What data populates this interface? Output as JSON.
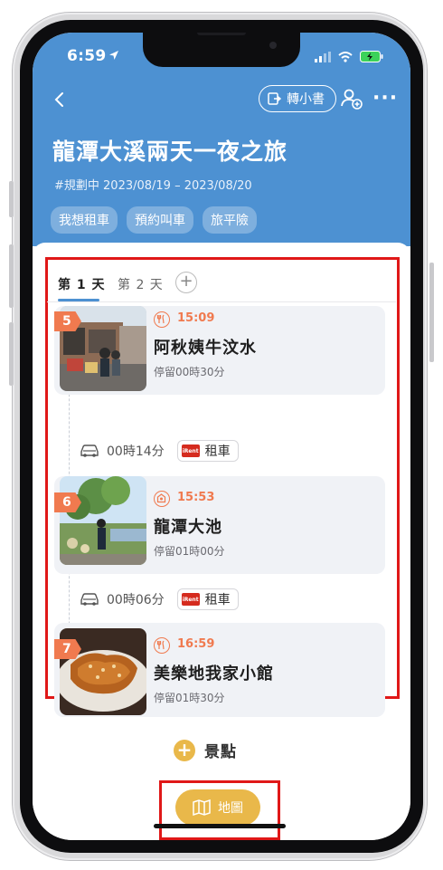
{
  "status_bar": {
    "time": "6:59"
  },
  "header": {
    "convert_label": "轉小書",
    "more_label": "···",
    "title": "龍潭大溪兩天一夜之旅",
    "subtitle": "#規劃中 2023/08/19 – 2023/08/20",
    "chips": [
      "我想租車",
      "預約叫車",
      "旅平險"
    ]
  },
  "tabs": {
    "day1": "第 1 天",
    "day2": "第 2 天",
    "add": "+"
  },
  "stops": [
    {
      "number": "5",
      "time": "15:09",
      "name": "阿秋姨牛汶水",
      "stay": "停留00時30分"
    },
    {
      "number": "6",
      "time": "15:53",
      "name": "龍潭大池",
      "stay": "停留01時00分"
    },
    {
      "number": "7",
      "time": "16:59",
      "name": "美樂地我家小館",
      "stay": "停留01時30分"
    }
  ],
  "transits": [
    {
      "duration": "00時14分",
      "rent_label": "租車",
      "logo_text": "iRent"
    },
    {
      "duration": "00時06分",
      "rent_label": "租車",
      "logo_text": "iRent"
    }
  ],
  "add_spot": {
    "icon": "+",
    "label": "景點"
  },
  "map_button": {
    "label": "地圖"
  },
  "colors": {
    "header_bg": "#4d91d2",
    "accent_orange": "#f07a4f",
    "map_yellow": "#e9b84a",
    "highlight_red": "#e01818"
  }
}
